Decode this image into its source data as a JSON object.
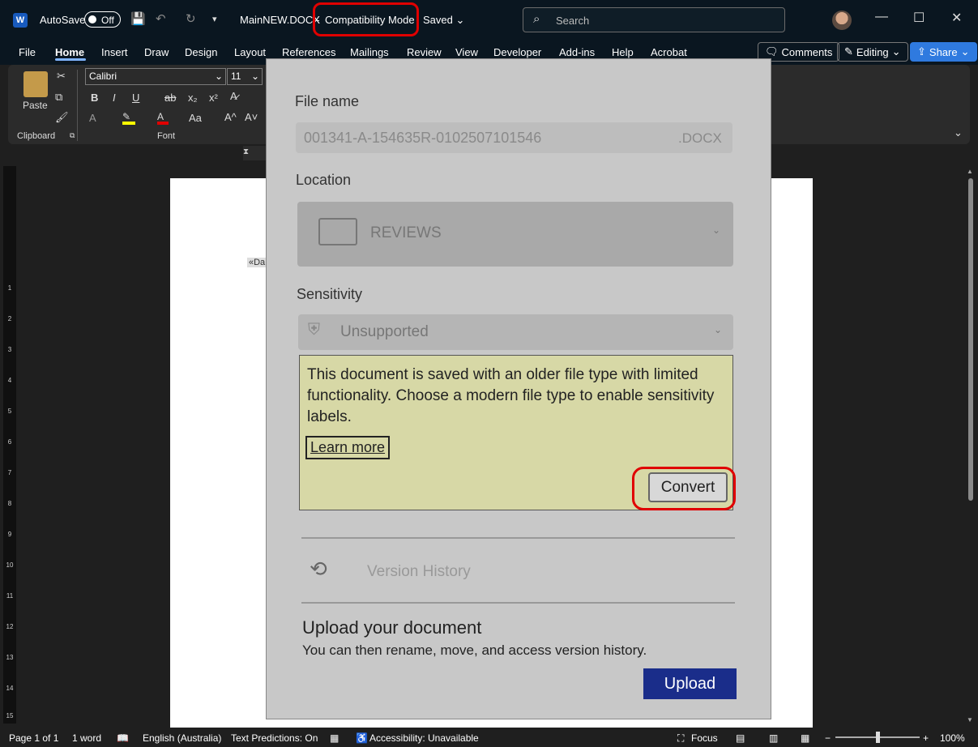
{
  "titlebar": {
    "word_logo": "W",
    "autosave_label": "AutoSave",
    "autosave_state": "Off",
    "filename": "MainNEW.DOCX",
    "separator": "-",
    "mode": "Compatibility Mode",
    "save_status": "Saved",
    "search_placeholder": "Search",
    "minimize": "—",
    "maximize": "☐",
    "close": "✕"
  },
  "tabs": [
    "File",
    "Home",
    "Insert",
    "Draw",
    "Design",
    "Layout",
    "References",
    "Mailings",
    "Review",
    "View",
    "Developer",
    "Add-ins",
    "Help",
    "Acrobat"
  ],
  "actions": {
    "comments": "Comments",
    "editing": "Editing",
    "share": "Share"
  },
  "ribbon": {
    "paste": "Paste",
    "clipboard": "Clipboard",
    "font_name": "Calibri",
    "font_size": "11",
    "font_group": "Font",
    "bold": "B",
    "italic": "I",
    "underline": "U",
    "strike": "ab",
    "sub": "x₂",
    "sup": "x²",
    "aa": "Aa",
    "grow": "A^",
    "shrink": "A˅"
  },
  "doc": {
    "field_fragment": "«Da"
  },
  "ruler": [
    "1",
    "2",
    "3",
    "4",
    "5",
    "6",
    "7",
    "8",
    "9",
    "10",
    "11",
    "12",
    "13",
    "14",
    "15"
  ],
  "status": {
    "page": "Page 1 of 1",
    "words": "1 word",
    "language": "English (Australia)",
    "predictions": "Text Predictions: On",
    "accessibility": "Accessibility: Unavailable",
    "focus": "Focus",
    "zoom": "100%"
  },
  "panel": {
    "file_name_label": "File name",
    "file_name_value": "001341-A-154635R-0102507101546",
    "file_ext": ".DOCX",
    "location_label": "Location",
    "location_value": "REVIEWS",
    "sensitivity_label": "Sensitivity",
    "sensitivity_value": "Unsupported",
    "warning_text": "This document is saved with an older file type with limited functionality. Choose a modern file type to enable sensitivity labels.",
    "learn_more": "Learn more",
    "convert": "Convert",
    "version_history": "Version History",
    "upload_title": "Upload your document",
    "upload_sub": "You can then rename, move, and access version history.",
    "upload_btn": "Upload"
  },
  "colors": {
    "highlight_red": "#e00000",
    "share_blue": "#2f7adf",
    "upload_blue": "#1a2d8a",
    "warning_bg": "#d7d8a6"
  }
}
